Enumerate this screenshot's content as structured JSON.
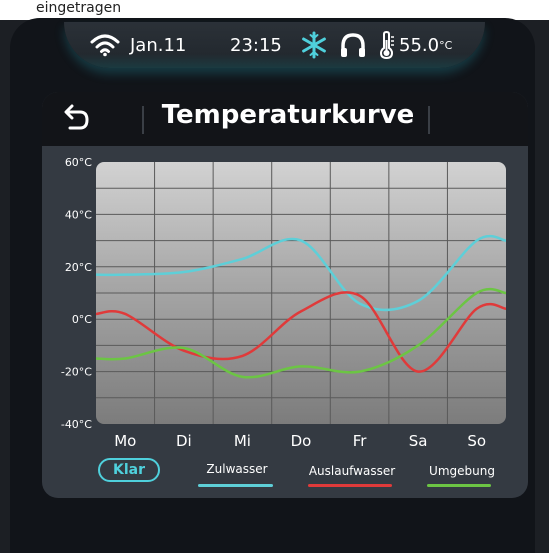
{
  "top_stub": {
    "text": "eingetragen"
  },
  "status_bar": {
    "date": "Jan.11",
    "time": "23:15",
    "temperature": "55.0",
    "temperature_unit": "°C",
    "icons": [
      "wifi-icon",
      "snowflake-icon",
      "headphones-icon",
      "thermometer-icon"
    ]
  },
  "header": {
    "title": "Temperaturkurve",
    "back_icon": "back-arrow-icon"
  },
  "chart": {
    "clear_button": "Klar"
  },
  "colors": {
    "accent": "#4fd0dc",
    "zulwasser": "#5ecfd8",
    "auslaufwasser": "#e03a3a",
    "umgebung": "#6cc544"
  },
  "chart_data": {
    "type": "line",
    "categories": [
      "Mo",
      "Di",
      "Mi",
      "Do",
      "Fr",
      "Sa",
      "So"
    ],
    "ylim": [
      -40,
      60
    ],
    "ytick_labels": [
      "60°C",
      "40°C",
      "20°C",
      "0°C",
      "-20°C",
      "-40°C"
    ],
    "y_ticks": [
      60,
      40,
      20,
      0,
      -20,
      -40
    ],
    "grid": true,
    "legend_position": "bottom",
    "series": [
      {
        "name": "Zulwasser",
        "values": [
          17,
          18,
          23,
          30,
          6,
          7,
          30
        ]
      },
      {
        "name": "Auslaufwasser",
        "values": [
          2,
          -12,
          -14,
          3,
          9,
          -20,
          4
        ]
      },
      {
        "name": "Umgebung",
        "values": [
          -15,
          -11,
          -22,
          -18,
          -20,
          -10,
          10
        ]
      }
    ]
  }
}
